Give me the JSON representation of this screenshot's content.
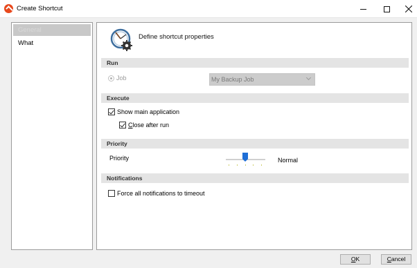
{
  "window": {
    "title": "Create Shortcut",
    "controls": {
      "minimize": "minimize",
      "maximize": "maximize",
      "close": "close"
    }
  },
  "sidebar": {
    "items": [
      {
        "label": "General",
        "selected": true
      },
      {
        "label": "What",
        "selected": false
      }
    ]
  },
  "header": {
    "title": "Define shortcut properties",
    "icon": "clock-gear-icon"
  },
  "sections": {
    "run": "Run",
    "execute": "Execute",
    "priority": "Priority",
    "notifications": "Notifications"
  },
  "run": {
    "radio_label": "Job",
    "radio_checked": true,
    "job_select_value": "My Backup Job"
  },
  "execute": {
    "show_main_label": "Show main application",
    "show_main_checked": true,
    "close_after_label_prefix": "",
    "close_after_mnemonic": "C",
    "close_after_label_rest": "lose after run",
    "close_after_checked": true
  },
  "priority": {
    "label": "Priority",
    "value_text": "Normal"
  },
  "notifications": {
    "force_timeout_label": "Force all notifications to timeout",
    "force_timeout_checked": false
  },
  "buttons": {
    "ok_mnemonic": "O",
    "ok_rest": "K",
    "cancel_mnemonic": "C",
    "cancel_rest": "ancel"
  },
  "colors": {
    "app_icon": "#e8491d",
    "slider_thumb": "#1e6ed6"
  }
}
